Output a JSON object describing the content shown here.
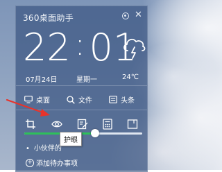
{
  "window": {
    "title": "360桌面助手"
  },
  "clock": {
    "hours": "22",
    "separator": ":",
    "minutes": "01"
  },
  "info": {
    "date": "07月24日",
    "weekday": "星期一",
    "temperature": "24℃"
  },
  "shortcuts": [
    {
      "label": "桌面",
      "icon": "monitor-icon"
    },
    {
      "label": "文件",
      "icon": "search-icon"
    },
    {
      "label": "头条",
      "icon": "newspaper-icon"
    }
  ],
  "toolbar": {
    "icons": [
      "crop-icon",
      "eye-icon",
      "edit-icon",
      "calculator-icon",
      "window-icon"
    ],
    "tooltip": "护眼"
  },
  "slider": {
    "value_fraction": 0.6
  },
  "todo": {
    "items": [
      "小伙伴的"
    ],
    "add_label": "添加待办事项"
  },
  "colors": {
    "panel": "#3c5682",
    "slider_fill": "#2ec05a",
    "annotation_arrow": "#e8332b"
  }
}
